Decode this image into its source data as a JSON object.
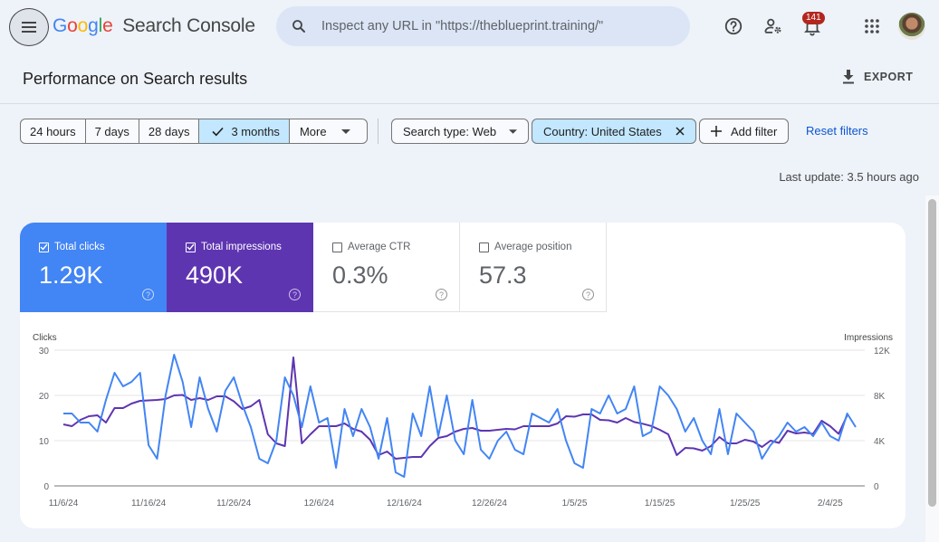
{
  "header": {
    "logo_google": [
      "G",
      "o",
      "o",
      "g",
      "l",
      "e"
    ],
    "product_name": "Search Console",
    "search_placeholder": "Inspect any URL in \"https://theblueprint.training/\"",
    "notification_count": "141",
    "icons": [
      "menu-icon",
      "search-icon",
      "help-icon",
      "manage-users-icon",
      "notifications-icon",
      "apps-icon",
      "avatar"
    ]
  },
  "page": {
    "title": "Performance on Search results",
    "export_label": "EXPORT"
  },
  "filters": {
    "date_ranges": [
      {
        "label": "24 hours",
        "active": false
      },
      {
        "label": "7 days",
        "active": false
      },
      {
        "label": "28 days",
        "active": false
      },
      {
        "label": "3 months",
        "active": true
      },
      {
        "label": "More",
        "active": false
      }
    ],
    "search_type": "Search type: Web",
    "country": "Country: United States",
    "add_filter": "Add filter",
    "reset": "Reset filters",
    "last_update": "Last update: 3.5 hours ago"
  },
  "metrics": [
    {
      "label": "Total clicks",
      "value": "1.29K",
      "checked": true,
      "color": "#4285f4"
    },
    {
      "label": "Total impressions",
      "value": "490K",
      "checked": true,
      "color": "#5e35b1"
    },
    {
      "label": "Average CTR",
      "value": "0.3%",
      "checked": false,
      "color": "#00897b"
    },
    {
      "label": "Average position",
      "value": "57.3",
      "checked": false,
      "color": "#e8710a"
    }
  ],
  "chart_data": {
    "type": "line",
    "title": "",
    "xlabel": "",
    "ylabel": "Clicks",
    "ylabel_right": "Impressions",
    "ylim": [
      0,
      30
    ],
    "ylim_right": [
      0,
      12000
    ],
    "yticks": [
      "0",
      "10",
      "20",
      "30"
    ],
    "yticks_right": [
      "0",
      "4K",
      "8K",
      "12K"
    ],
    "xtick_labels": [
      "11/6/24",
      "11/16/24",
      "11/26/24",
      "12/6/24",
      "12/16/24",
      "12/26/24",
      "1/5/25",
      "1/15/25",
      "1/25/25",
      "2/4/25"
    ],
    "grid": true,
    "legend": "none",
    "start_date": "11/6/24",
    "series": [
      {
        "name": "Clicks",
        "axis": "left",
        "color": "#4285f4",
        "values": [
          16,
          16,
          14,
          14,
          12,
          19,
          25,
          22,
          23,
          25,
          9,
          6,
          20,
          29,
          23,
          13,
          24,
          17,
          12,
          21,
          24,
          18,
          13,
          6,
          5,
          10,
          24,
          20,
          13,
          22,
          14,
          15,
          4,
          17,
          11,
          17,
          13,
          6,
          15,
          3,
          2,
          16,
          11,
          22,
          11,
          20,
          10,
          7,
          19,
          8,
          6,
          10,
          12,
          8,
          7,
          16,
          15,
          14,
          17,
          10,
          5,
          4,
          17,
          16,
          20,
          16,
          17,
          22,
          11,
          12,
          22,
          20,
          17,
          12,
          15,
          10,
          7,
          17,
          7,
          16,
          14,
          12,
          6,
          9,
          11,
          14,
          12,
          13,
          11,
          14,
          11,
          10,
          16,
          13
        ]
      },
      {
        "name": "Impressions",
        "axis": "right",
        "color": "#5e35b1",
        "values": [
          5440,
          5280,
          5840,
          6160,
          6240,
          5600,
          6880,
          6880,
          7280,
          7520,
          7560,
          7600,
          7680,
          8000,
          8040,
          7600,
          7760,
          7600,
          7920,
          7920,
          7480,
          6800,
          7040,
          7600,
          4560,
          3760,
          3520,
          11360,
          3760,
          4560,
          5280,
          5280,
          5280,
          5520,
          5040,
          4800,
          4080,
          2720,
          3040,
          2400,
          2480,
          2560,
          2560,
          3520,
          4240,
          4400,
          4800,
          5040,
          5120,
          4880,
          4880,
          4960,
          5040,
          5000,
          5280,
          5280,
          5280,
          5280,
          5520,
          6160,
          6120,
          6320,
          6320,
          5840,
          5800,
          5600,
          6000,
          5650,
          5500,
          5300,
          4960,
          4560,
          2720,
          3360,
          3320,
          3120,
          3520,
          4320,
          3760,
          3760,
          4080,
          3920,
          3440,
          4000,
          3800,
          4880,
          4640,
          4720,
          4600,
          5760,
          5280,
          4600,
          6240
        ]
      }
    ]
  }
}
